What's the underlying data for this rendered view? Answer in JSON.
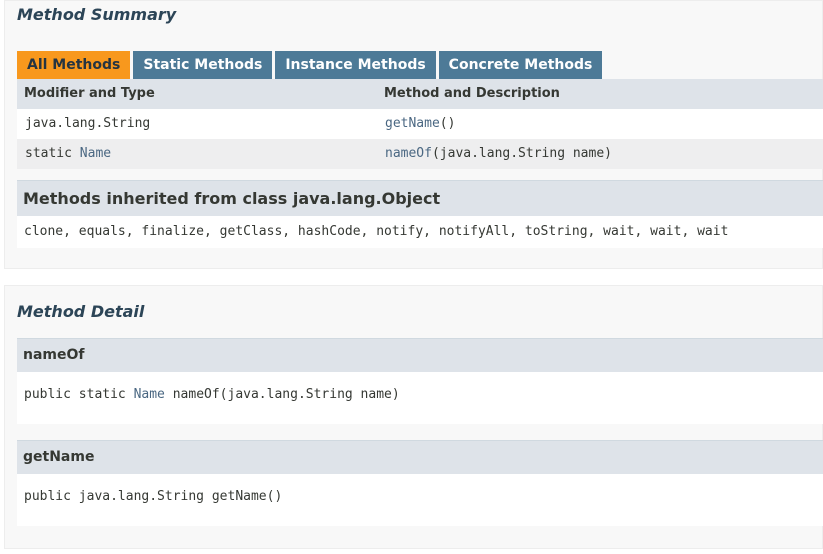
{
  "summary": {
    "title": "Method Summary",
    "tabs": [
      {
        "label": "All Methods",
        "active": true
      },
      {
        "label": "Static Methods",
        "active": false
      },
      {
        "label": "Instance Methods",
        "active": false
      },
      {
        "label": "Concrete Methods",
        "active": false
      }
    ],
    "columns": [
      "Modifier and Type",
      "Method and Description"
    ],
    "rows": [
      {
        "modifier": "java.lang.String",
        "modifier_link": "",
        "method_link": "getName",
        "method_rest": "()"
      },
      {
        "modifier": "static ",
        "modifier_link": "Name",
        "method_link": "nameOf",
        "method_rest": "(java.lang.String name)"
      }
    ],
    "inherited": {
      "title": "Methods inherited from class java.lang.Object",
      "methods": "clone, equals, finalize, getClass, hashCode, notify, notifyAll, toString, wait, wait, wait"
    }
  },
  "detail": {
    "title": "Method Detail",
    "methods": [
      {
        "name": "nameOf",
        "sig_prefix": "public static ",
        "sig_type": "Name",
        "sig_rest": " nameOf(java.lang.String name)"
      },
      {
        "name": "getName",
        "sig_prefix": "public java.lang.String getName()",
        "sig_type": "",
        "sig_rest": ""
      }
    ]
  },
  "colors": {
    "tab_active": "#f8981d",
    "tab_inactive": "#4d7a97",
    "header_bg": "#dee3e9",
    "link": "#4a6782"
  }
}
